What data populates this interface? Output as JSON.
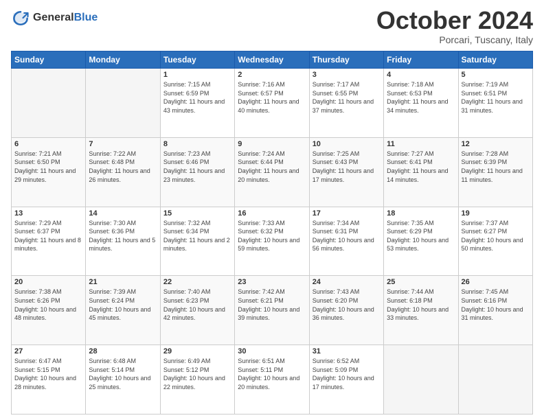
{
  "header": {
    "logo_line1": "General",
    "logo_line2": "Blue",
    "month": "October 2024",
    "location": "Porcari, Tuscany, Italy"
  },
  "days_of_week": [
    "Sunday",
    "Monday",
    "Tuesday",
    "Wednesday",
    "Thursday",
    "Friday",
    "Saturday"
  ],
  "weeks": [
    [
      {
        "day": "",
        "empty": true
      },
      {
        "day": "",
        "empty": true
      },
      {
        "day": "1",
        "sunrise": "7:15 AM",
        "sunset": "6:59 PM",
        "daylight": "11 hours and 43 minutes."
      },
      {
        "day": "2",
        "sunrise": "7:16 AM",
        "sunset": "6:57 PM",
        "daylight": "11 hours and 40 minutes."
      },
      {
        "day": "3",
        "sunrise": "7:17 AM",
        "sunset": "6:55 PM",
        "daylight": "11 hours and 37 minutes."
      },
      {
        "day": "4",
        "sunrise": "7:18 AM",
        "sunset": "6:53 PM",
        "daylight": "11 hours and 34 minutes."
      },
      {
        "day": "5",
        "sunrise": "7:19 AM",
        "sunset": "6:51 PM",
        "daylight": "11 hours and 31 minutes."
      }
    ],
    [
      {
        "day": "6",
        "sunrise": "7:21 AM",
        "sunset": "6:50 PM",
        "daylight": "11 hours and 29 minutes."
      },
      {
        "day": "7",
        "sunrise": "7:22 AM",
        "sunset": "6:48 PM",
        "daylight": "11 hours and 26 minutes."
      },
      {
        "day": "8",
        "sunrise": "7:23 AM",
        "sunset": "6:46 PM",
        "daylight": "11 hours and 23 minutes."
      },
      {
        "day": "9",
        "sunrise": "7:24 AM",
        "sunset": "6:44 PM",
        "daylight": "11 hours and 20 minutes."
      },
      {
        "day": "10",
        "sunrise": "7:25 AM",
        "sunset": "6:43 PM",
        "daylight": "11 hours and 17 minutes."
      },
      {
        "day": "11",
        "sunrise": "7:27 AM",
        "sunset": "6:41 PM",
        "daylight": "11 hours and 14 minutes."
      },
      {
        "day": "12",
        "sunrise": "7:28 AM",
        "sunset": "6:39 PM",
        "daylight": "11 hours and 11 minutes."
      }
    ],
    [
      {
        "day": "13",
        "sunrise": "7:29 AM",
        "sunset": "6:37 PM",
        "daylight": "11 hours and 8 minutes."
      },
      {
        "day": "14",
        "sunrise": "7:30 AM",
        "sunset": "6:36 PM",
        "daylight": "11 hours and 5 minutes."
      },
      {
        "day": "15",
        "sunrise": "7:32 AM",
        "sunset": "6:34 PM",
        "daylight": "11 hours and 2 minutes."
      },
      {
        "day": "16",
        "sunrise": "7:33 AM",
        "sunset": "6:32 PM",
        "daylight": "10 hours and 59 minutes."
      },
      {
        "day": "17",
        "sunrise": "7:34 AM",
        "sunset": "6:31 PM",
        "daylight": "10 hours and 56 minutes."
      },
      {
        "day": "18",
        "sunrise": "7:35 AM",
        "sunset": "6:29 PM",
        "daylight": "10 hours and 53 minutes."
      },
      {
        "day": "19",
        "sunrise": "7:37 AM",
        "sunset": "6:27 PM",
        "daylight": "10 hours and 50 minutes."
      }
    ],
    [
      {
        "day": "20",
        "sunrise": "7:38 AM",
        "sunset": "6:26 PM",
        "daylight": "10 hours and 48 minutes."
      },
      {
        "day": "21",
        "sunrise": "7:39 AM",
        "sunset": "6:24 PM",
        "daylight": "10 hours and 45 minutes."
      },
      {
        "day": "22",
        "sunrise": "7:40 AM",
        "sunset": "6:23 PM",
        "daylight": "10 hours and 42 minutes."
      },
      {
        "day": "23",
        "sunrise": "7:42 AM",
        "sunset": "6:21 PM",
        "daylight": "10 hours and 39 minutes."
      },
      {
        "day": "24",
        "sunrise": "7:43 AM",
        "sunset": "6:20 PM",
        "daylight": "10 hours and 36 minutes."
      },
      {
        "day": "25",
        "sunrise": "7:44 AM",
        "sunset": "6:18 PM",
        "daylight": "10 hours and 33 minutes."
      },
      {
        "day": "26",
        "sunrise": "7:45 AM",
        "sunset": "6:16 PM",
        "daylight": "10 hours and 31 minutes."
      }
    ],
    [
      {
        "day": "27",
        "sunrise": "6:47 AM",
        "sunset": "5:15 PM",
        "daylight": "10 hours and 28 minutes."
      },
      {
        "day": "28",
        "sunrise": "6:48 AM",
        "sunset": "5:14 PM",
        "daylight": "10 hours and 25 minutes."
      },
      {
        "day": "29",
        "sunrise": "6:49 AM",
        "sunset": "5:12 PM",
        "daylight": "10 hours and 22 minutes."
      },
      {
        "day": "30",
        "sunrise": "6:51 AM",
        "sunset": "5:11 PM",
        "daylight": "10 hours and 20 minutes."
      },
      {
        "day": "31",
        "sunrise": "6:52 AM",
        "sunset": "5:09 PM",
        "daylight": "10 hours and 17 minutes."
      },
      {
        "day": "",
        "empty": true
      },
      {
        "day": "",
        "empty": true
      }
    ]
  ]
}
